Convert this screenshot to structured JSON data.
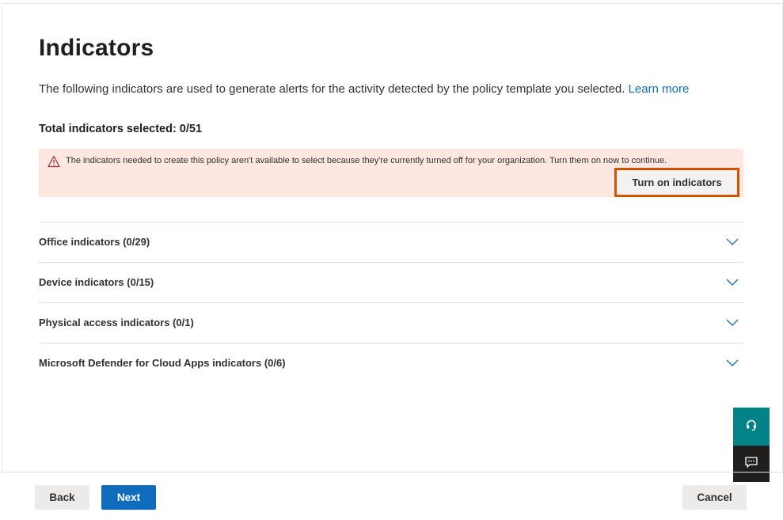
{
  "header": {
    "title": "Indicators",
    "description": "The following indicators are used to generate alerts for the activity detected by the policy template you selected.",
    "learn_more": "Learn more",
    "total_selected": "Total indicators selected: 0/51"
  },
  "warning": {
    "icon": "warning-triangle-icon",
    "message": "The indicators needed to create this policy aren't available to select because they're currently turned off for your organization. Turn them on now to continue.",
    "button_label": "Turn on indicators",
    "color": "#fde7e0",
    "highlight_color": "#d35400"
  },
  "accordion": {
    "items": [
      {
        "label": "Office indicators (0/29)"
      },
      {
        "label": "Device indicators (0/15)"
      },
      {
        "label": "Physical access indicators (0/1)"
      },
      {
        "label": "Microsoft Defender for Cloud Apps indicators (0/6)"
      }
    ]
  },
  "side_actions": {
    "help_icon": "headset-help-icon",
    "feedback_icon": "feedback-chat-icon"
  },
  "footer": {
    "back_label": "Back",
    "next_label": "Next",
    "cancel_label": "Cancel"
  },
  "colors": {
    "accent": "#0f6cbd",
    "teal": "#038387"
  }
}
